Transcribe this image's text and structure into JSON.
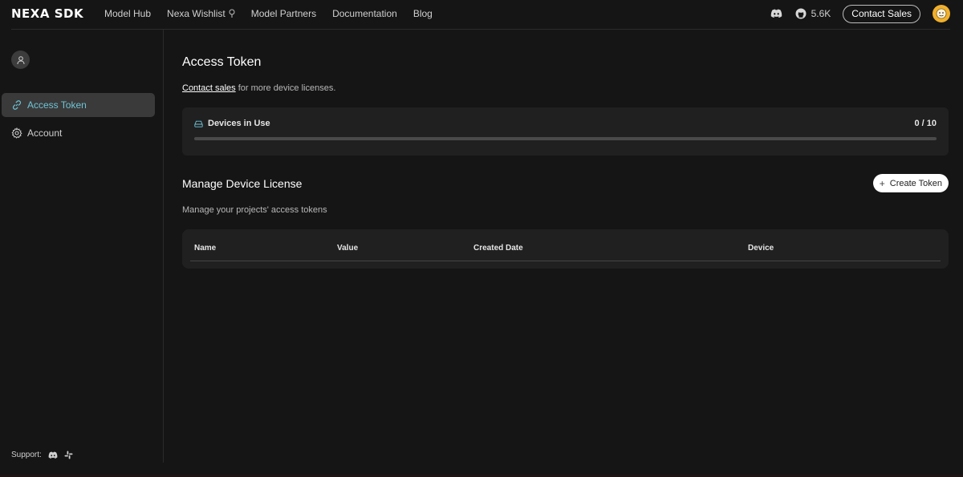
{
  "header": {
    "logo": "NEXA SDK",
    "nav": [
      "Model Hub",
      "Nexa Wishlist",
      "Model Partners",
      "Documentation",
      "Blog"
    ],
    "github_stars": "5.6K",
    "contact_label": "Contact Sales"
  },
  "sidebar": {
    "items": [
      {
        "label": "Access Token",
        "icon": "link-icon",
        "active": true
      },
      {
        "label": "Account",
        "icon": "gear-icon",
        "active": false
      }
    ],
    "support_label": "Support:"
  },
  "main": {
    "title": "Access Token",
    "contact_link": "Contact sales",
    "contact_suffix": " for more device licenses.",
    "devices": {
      "label": "Devices in Use",
      "count": "0 / 10",
      "used": 0,
      "total": 10
    },
    "manage": {
      "title": "Manage Device License",
      "create_label": "Create Token",
      "subtitle": "Manage your projects' access tokens"
    },
    "table": {
      "columns": [
        "Name",
        "Value",
        "Created Date",
        "Device"
      ]
    }
  },
  "colors": {
    "accent": "#6fc3d6",
    "background": "#151515",
    "card": "#202020",
    "avatar": "#f0b02c"
  }
}
